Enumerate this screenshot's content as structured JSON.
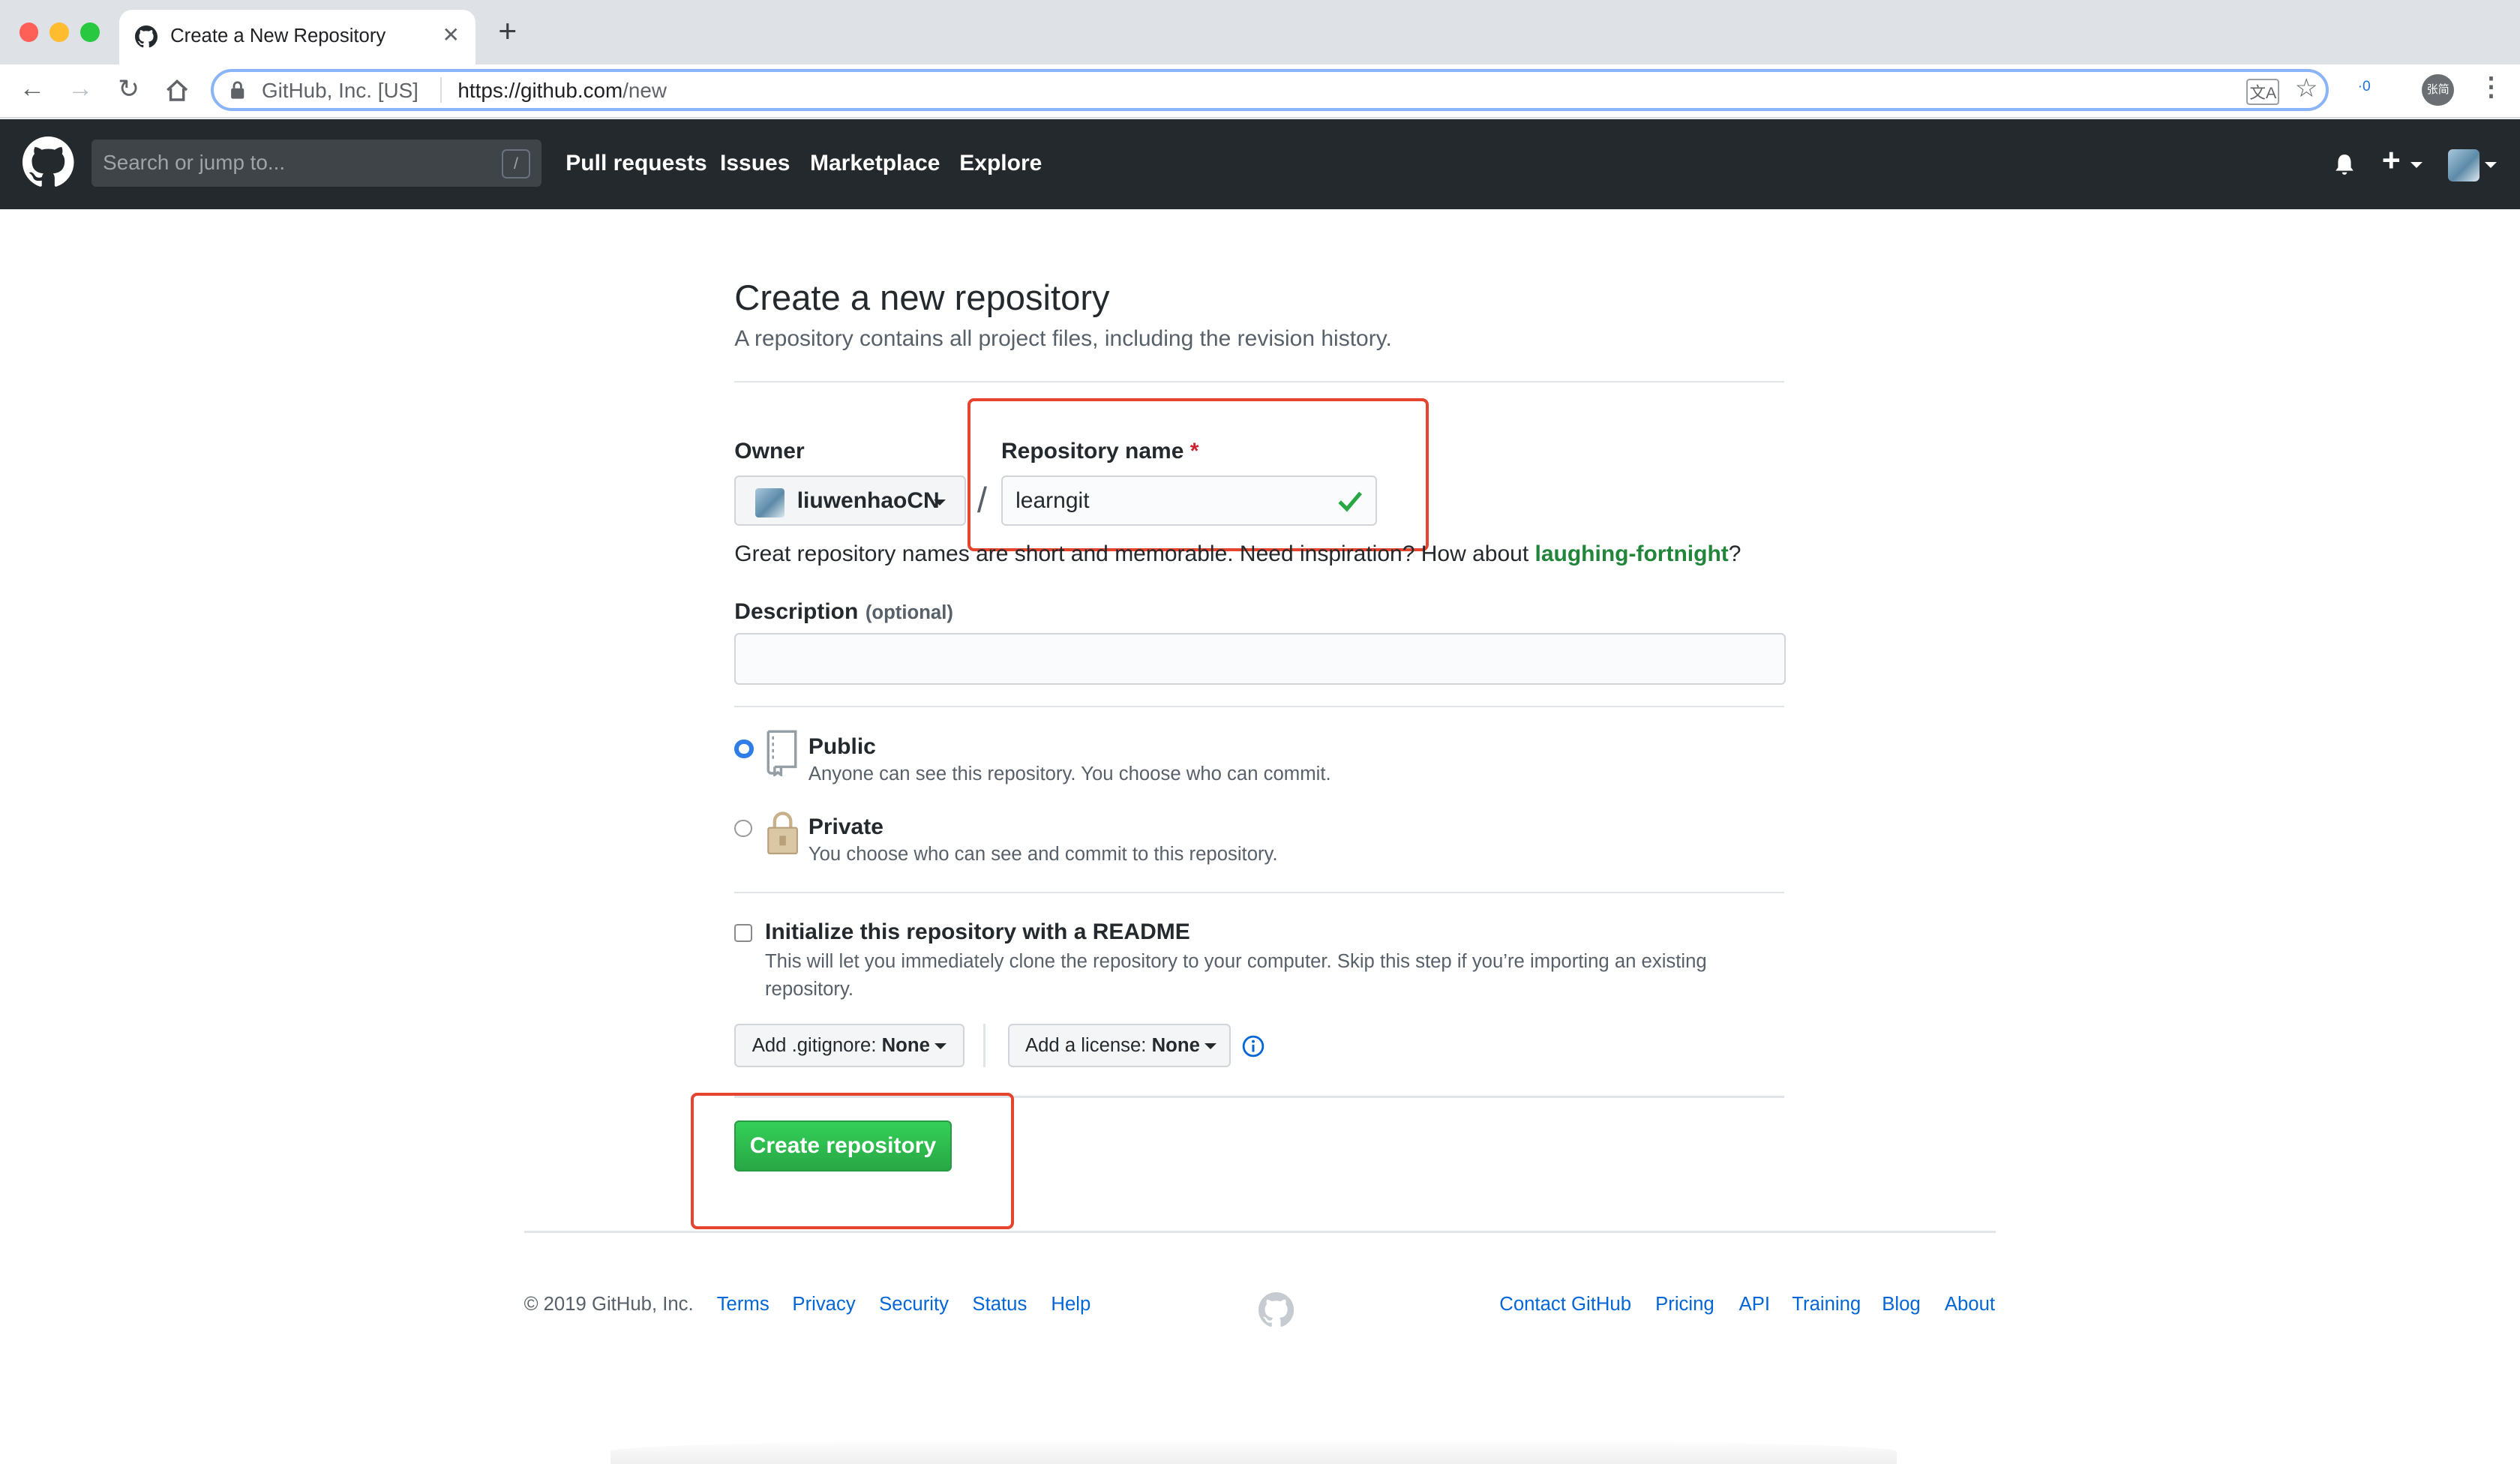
{
  "browser": {
    "tab_title": "Create a New Repository",
    "new_tab_symbol": "+",
    "site_identity": "GitHub, Inc. [US]",
    "url_domain": "https://github.com",
    "url_path": "/new",
    "translate_badge": "文A",
    "extension_badge": "·0",
    "profile_label": "张简"
  },
  "gh_header": {
    "search_placeholder": "Search or jump to...",
    "search_shortcut": "/",
    "nav": [
      "Pull requests",
      "Issues",
      "Marketplace",
      "Explore"
    ],
    "plus_symbol": "+"
  },
  "page": {
    "title": "Create a new repository",
    "subtitle": "A repository contains all project files, including the revision history.",
    "owner_label": "Owner",
    "owner_value": "liuwenhaoCN",
    "slash": "/",
    "repo_name_label": "Repository name",
    "required_mark": "*",
    "repo_name_value": "learngit",
    "hint_text": "Great repository names are short and memorable. Need inspiration? How about",
    "suggestion": "laughing-fortnight",
    "hint_end": "?",
    "description_label": "Description",
    "description_optional": "(optional)",
    "description_value": "",
    "visibility": [
      {
        "label": "Public",
        "desc": "Anyone can see this repository. You choose who can commit.",
        "selected": true
      },
      {
        "label": "Private",
        "desc": "You choose who can see and commit to this repository.",
        "selected": false
      }
    ],
    "readme_label": "Initialize this repository with a README",
    "readme_desc": "This will let you immediately clone the repository to your computer. Skip this step if you’re importing an existing repository.",
    "readme_checked": false,
    "gitignore_prefix": "Add .gitignore:",
    "gitignore_value": "None",
    "license_prefix": "Add a license:",
    "license_value": "None",
    "create_button": "Create repository"
  },
  "footer": {
    "copyright": "© 2019 GitHub, Inc.",
    "left_links": [
      "Terms",
      "Privacy",
      "Security",
      "Status",
      "Help"
    ],
    "right_links": [
      "Contact GitHub",
      "Pricing",
      "API",
      "Training",
      "Blog",
      "About"
    ]
  },
  "colors": {
    "accent_green": "#2ea44f",
    "link_blue": "#0366d6",
    "highlight_red": "#e5452e",
    "header_bg": "#24292e"
  }
}
